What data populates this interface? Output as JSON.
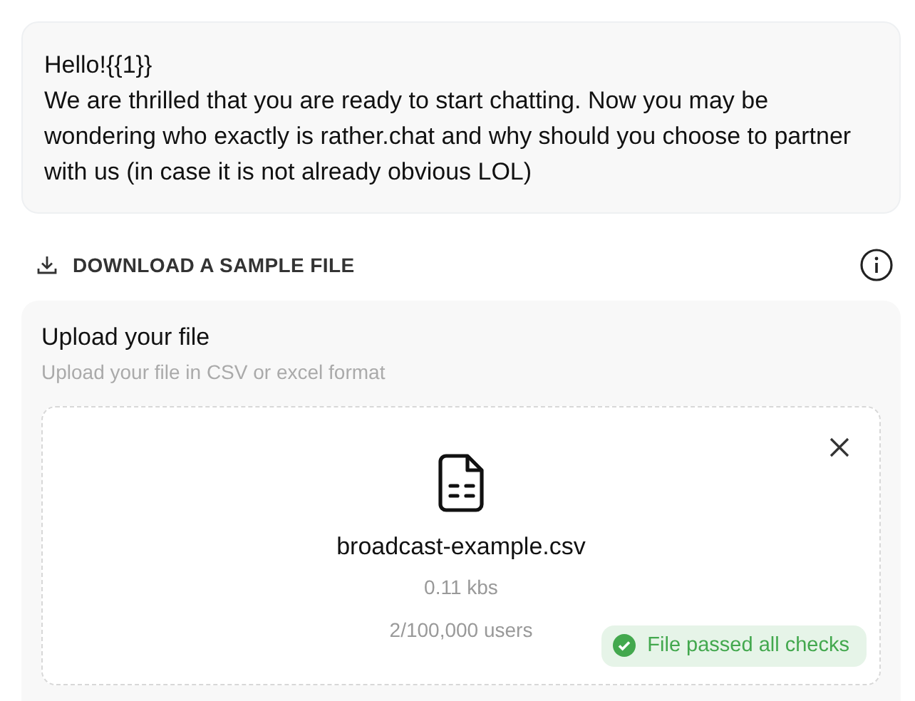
{
  "message": {
    "lines": [
      "Hello!{{1}}",
      "We are thrilled that you are ready to start chatting. Now you may be wondering who exactly is rather.chat and why should you choose to partner with us (in case it is not already obvious LOL)"
    ]
  },
  "download": {
    "label": "DOWNLOAD A SAMPLE FILE"
  },
  "upload": {
    "title": "Upload your file",
    "subtitle": "Upload your file in CSV or excel format",
    "file": {
      "name": "broadcast-example.csv",
      "size": "0.11 kbs",
      "users": "2/100,000 users"
    },
    "status": {
      "text": "File passed all checks",
      "kind": "success"
    }
  }
}
